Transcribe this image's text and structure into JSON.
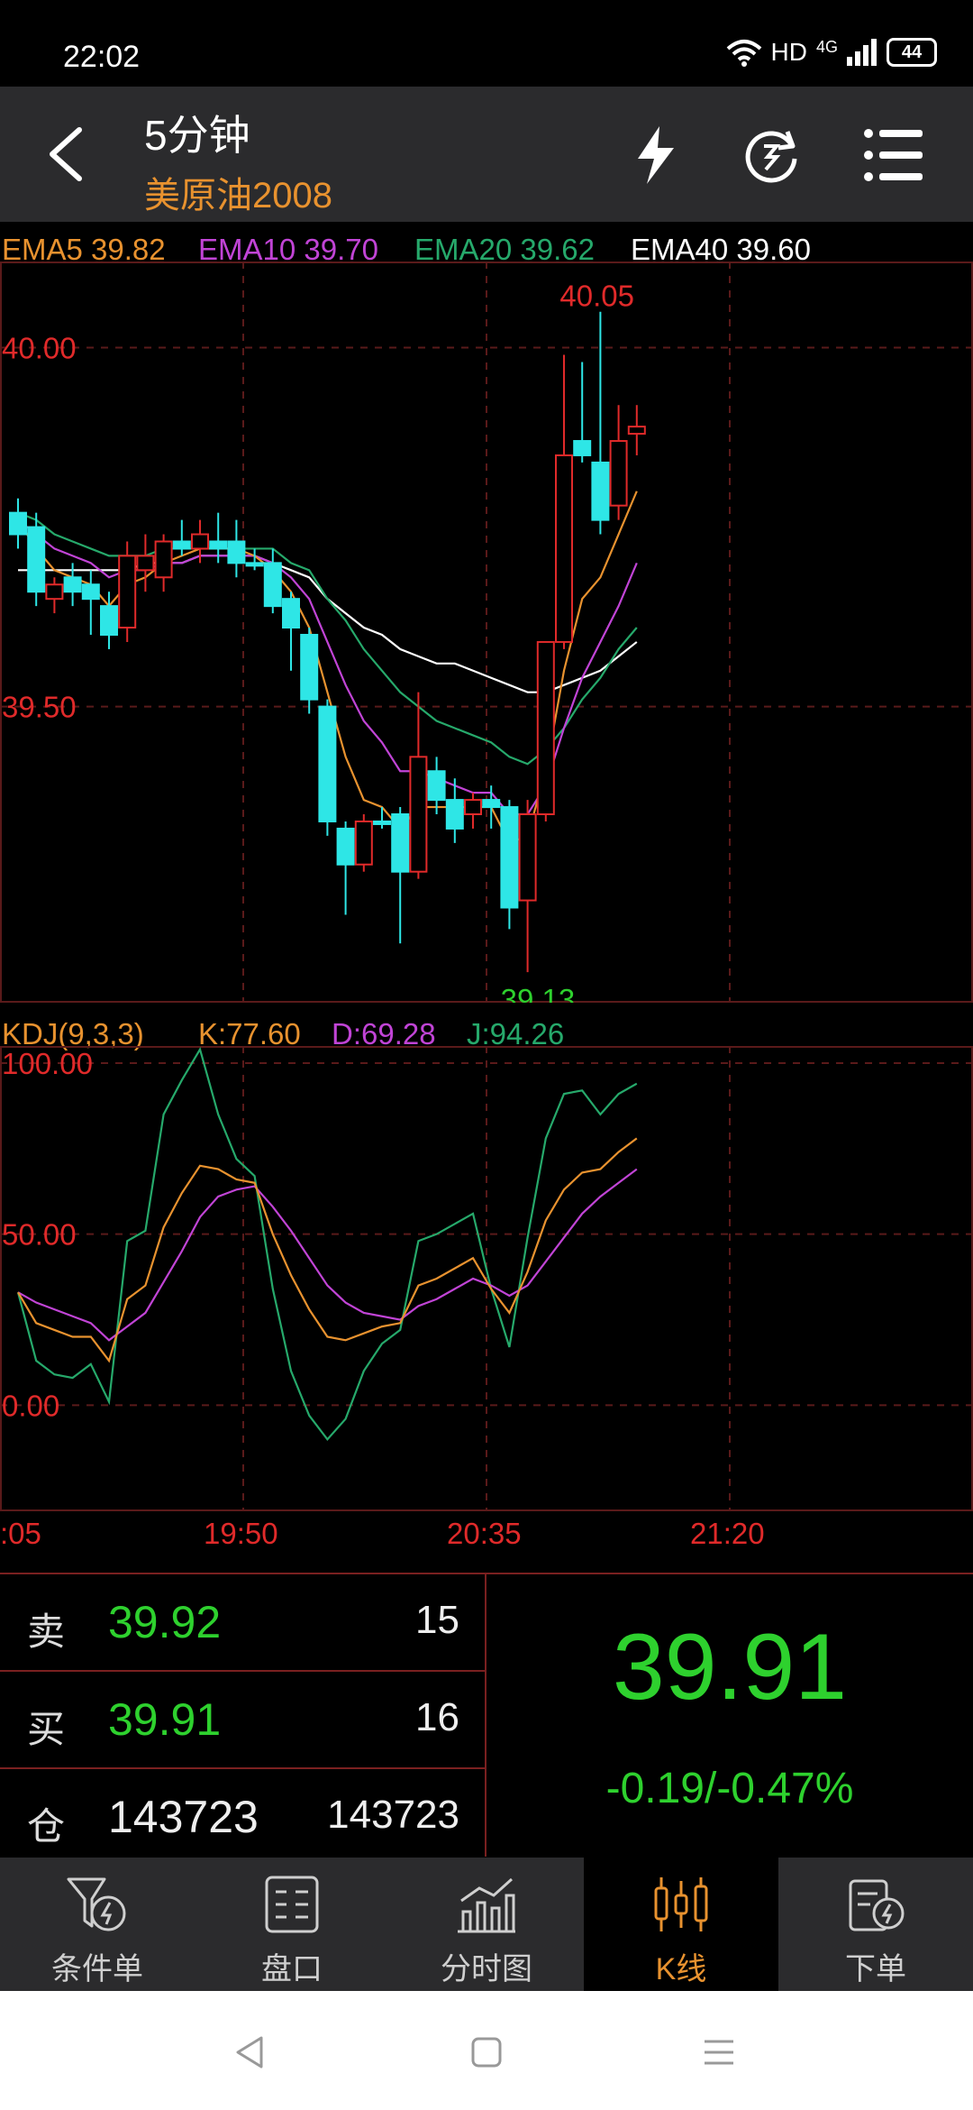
{
  "status_bar": {
    "time": "22:02",
    "network": "HD",
    "signal": "4G",
    "battery": "44"
  },
  "header": {
    "title": "5分钟",
    "subtitle": "美原油2008",
    "icons": [
      "back-icon",
      "lightning-icon",
      "refresh-icon",
      "menu-icon"
    ]
  },
  "ema_legend": [
    {
      "label": "EMA5 39.82",
      "color": "#e8922f"
    },
    {
      "label": "EMA10 39.70",
      "color": "#c144d6"
    },
    {
      "label": "EMA20 39.62",
      "color": "#26a96b"
    },
    {
      "label": "EMA40 39.60",
      "color": "#ffffff"
    }
  ],
  "kdj_legend": [
    {
      "label": "KDJ(9,3,3)",
      "color": "#e8922f"
    },
    {
      "label": "K:77.60",
      "color": "#e8922f"
    },
    {
      "label": "D:69.28",
      "color": "#c144d6"
    },
    {
      "label": "J:94.26",
      "color": "#26a96b"
    }
  ],
  "chart_data": [
    {
      "type": "candlestick",
      "title": "",
      "y_ticks": [
        "40.00",
        "39.50"
      ],
      "ylim": [
        39.09,
        40.12
      ],
      "high_label": "40.05",
      "low_label": "39.13",
      "colors": {
        "up": "#e02a2a",
        "down": "#2ee6e6",
        "ema5": "#e8922f",
        "ema10": "#c144d6",
        "ema20": "#26a96b",
        "ema40": "#ffffff"
      },
      "candles": [
        {
          "o": 39.77,
          "h": 39.79,
          "c": 39.74,
          "l": 39.72
        },
        {
          "o": 39.75,
          "h": 39.77,
          "c": 39.66,
          "l": 39.64
        },
        {
          "o": 39.65,
          "h": 39.68,
          "c": 39.67,
          "l": 39.63
        },
        {
          "o": 39.68,
          "h": 39.7,
          "c": 39.66,
          "l": 39.64
        },
        {
          "o": 39.67,
          "h": 39.69,
          "c": 39.65,
          "l": 39.6
        },
        {
          "o": 39.64,
          "h": 39.66,
          "c": 39.6,
          "l": 39.58
        },
        {
          "o": 39.61,
          "h": 39.73,
          "c": 39.71,
          "l": 39.59
        },
        {
          "o": 39.69,
          "h": 39.74,
          "c": 39.71,
          "l": 39.66
        },
        {
          "o": 39.68,
          "h": 39.74,
          "c": 39.73,
          "l": 39.66
        },
        {
          "o": 39.73,
          "h": 39.76,
          "c": 39.72,
          "l": 39.71
        },
        {
          "o": 39.72,
          "h": 39.76,
          "c": 39.74,
          "l": 39.7
        },
        {
          "o": 39.73,
          "h": 39.77,
          "c": 39.72,
          "l": 39.7
        },
        {
          "o": 39.73,
          "h": 39.76,
          "c": 39.7,
          "l": 39.68
        },
        {
          "o": 39.7,
          "h": 39.72,
          "c": 39.7,
          "l": 39.69
        },
        {
          "o": 39.7,
          "h": 39.72,
          "c": 39.64,
          "l": 39.63
        },
        {
          "o": 39.65,
          "h": 39.66,
          "c": 39.61,
          "l": 39.55
        },
        {
          "o": 39.6,
          "h": 39.61,
          "c": 39.51,
          "l": 39.49
        },
        {
          "o": 39.5,
          "h": 39.51,
          "c": 39.34,
          "l": 39.32
        },
        {
          "o": 39.33,
          "h": 39.34,
          "c": 39.28,
          "l": 39.21
        },
        {
          "o": 39.28,
          "h": 39.35,
          "c": 39.34,
          "l": 39.27
        },
        {
          "o": 39.34,
          "h": 39.36,
          "c": 39.34,
          "l": 39.33
        },
        {
          "o": 39.35,
          "h": 39.36,
          "c": 39.27,
          "l": 39.17
        },
        {
          "o": 39.27,
          "h": 39.52,
          "c": 39.43,
          "l": 39.26
        },
        {
          "o": 39.41,
          "h": 39.43,
          "c": 39.37,
          "l": 39.35
        },
        {
          "o": 39.37,
          "h": 39.4,
          "c": 39.33,
          "l": 39.31
        },
        {
          "o": 39.35,
          "h": 39.38,
          "c": 39.37,
          "l": 39.33
        },
        {
          "o": 39.37,
          "h": 39.39,
          "c": 39.36,
          "l": 39.33
        },
        {
          "o": 39.36,
          "h": 39.37,
          "c": 39.22,
          "l": 39.19
        },
        {
          "o": 39.23,
          "h": 39.37,
          "c": 39.35,
          "l": 39.13
        },
        {
          "o": 39.35,
          "h": 39.59,
          "c": 39.59,
          "l": 39.34
        },
        {
          "o": 39.59,
          "h": 39.99,
          "c": 39.85,
          "l": 39.58
        },
        {
          "o": 39.87,
          "h": 39.98,
          "c": 39.85,
          "l": 39.84
        },
        {
          "o": 39.84,
          "h": 40.05,
          "c": 39.76,
          "l": 39.74
        },
        {
          "o": 39.78,
          "h": 39.92,
          "c": 39.87,
          "l": 39.76
        },
        {
          "o": 39.88,
          "h": 39.92,
          "c": 39.89,
          "l": 39.85
        }
      ],
      "ema5": [
        39.76,
        39.72,
        39.69,
        39.68,
        39.67,
        39.64,
        39.67,
        39.68,
        39.7,
        39.71,
        39.72,
        39.72,
        39.72,
        39.71,
        39.69,
        39.66,
        39.61,
        39.52,
        39.43,
        39.37,
        39.36,
        39.33,
        39.36,
        39.36,
        39.36,
        39.36,
        39.36,
        39.31,
        39.32,
        39.41,
        39.55,
        39.65,
        39.68,
        39.74,
        39.8
      ],
      "ema10": [
        39.76,
        39.74,
        39.72,
        39.71,
        39.7,
        39.68,
        39.69,
        39.69,
        39.7,
        39.7,
        39.71,
        39.71,
        39.71,
        39.71,
        39.7,
        39.68,
        39.65,
        39.59,
        39.53,
        39.48,
        39.45,
        39.41,
        39.41,
        39.4,
        39.39,
        39.38,
        39.38,
        39.35,
        39.35,
        39.39,
        39.47,
        39.54,
        39.59,
        39.64,
        39.7
      ],
      "ema20": [
        39.77,
        39.76,
        39.74,
        39.73,
        39.72,
        39.71,
        39.71,
        39.71,
        39.72,
        39.72,
        39.72,
        39.72,
        39.72,
        39.72,
        39.72,
        39.7,
        39.69,
        39.65,
        39.62,
        39.58,
        39.55,
        39.52,
        39.5,
        39.48,
        39.47,
        39.46,
        39.45,
        39.43,
        39.42,
        39.44,
        39.47,
        39.51,
        39.54,
        39.58,
        39.61
      ],
      "ema40": [
        39.69,
        39.69,
        39.69,
        39.69,
        39.69,
        39.69,
        39.69,
        39.7,
        39.7,
        39.7,
        39.71,
        39.71,
        39.71,
        39.71,
        39.7,
        39.69,
        39.68,
        39.65,
        39.63,
        39.61,
        39.6,
        39.58,
        39.57,
        39.56,
        39.56,
        39.55,
        39.54,
        39.53,
        39.52,
        39.52,
        39.53,
        39.54,
        39.55,
        39.57,
        39.59
      ]
    },
    {
      "type": "line",
      "title": "",
      "y_ticks": [
        "100.00",
        "50.00",
        "0.00"
      ],
      "ylim": [
        -31,
        105
      ],
      "x_ticks": [
        ":05",
        "19:50",
        "20:35",
        "21:20"
      ],
      "series": [
        {
          "name": "K",
          "color": "#e8922f",
          "values": [
            33,
            24,
            22,
            20,
            20,
            13,
            31,
            35,
            52,
            62,
            70,
            69,
            66,
            65,
            50,
            38,
            28,
            20,
            19,
            21,
            23,
            24,
            35,
            37,
            40,
            43,
            34,
            27,
            39,
            54,
            63,
            68,
            69,
            74,
            78
          ]
        },
        {
          "name": "D",
          "color": "#c144d6",
          "values": [
            33,
            30,
            28,
            26,
            24,
            19,
            23,
            27,
            36,
            45,
            55,
            61,
            63,
            64,
            58,
            51,
            43,
            35,
            30,
            27,
            26,
            25,
            29,
            31,
            34,
            37,
            35,
            32,
            35,
            42,
            49,
            56,
            61,
            65,
            69
          ]
        },
        {
          "name": "J",
          "color": "#26a96b",
          "values": [
            33,
            13,
            9,
            8,
            12,
            1,
            48,
            51,
            85,
            95,
            104,
            85,
            72,
            67,
            34,
            10,
            -3,
            -10,
            -4,
            10,
            18,
            22,
            48,
            50,
            53,
            56,
            34,
            17,
            49,
            78,
            91,
            92,
            85,
            91,
            94
          ]
        }
      ]
    }
  ],
  "quote": {
    "rows": [
      {
        "label": "卖",
        "price": "39.92",
        "volume": "15"
      },
      {
        "label": "买",
        "price": "39.91",
        "volume": "16"
      },
      {
        "label": "仓",
        "price": "143723",
        "volume": "143723"
      }
    ],
    "last_price": "39.91",
    "change": "-0.19/-0.47%"
  },
  "tabs": [
    {
      "label": "条件单",
      "icon": "conditional-order-icon"
    },
    {
      "label": "盘口",
      "icon": "order-book-icon"
    },
    {
      "label": "分时图",
      "icon": "timeshare-chart-icon"
    },
    {
      "label": "K线",
      "icon": "kline-icon",
      "active": true
    },
    {
      "label": "下单",
      "icon": "place-order-icon"
    }
  ]
}
